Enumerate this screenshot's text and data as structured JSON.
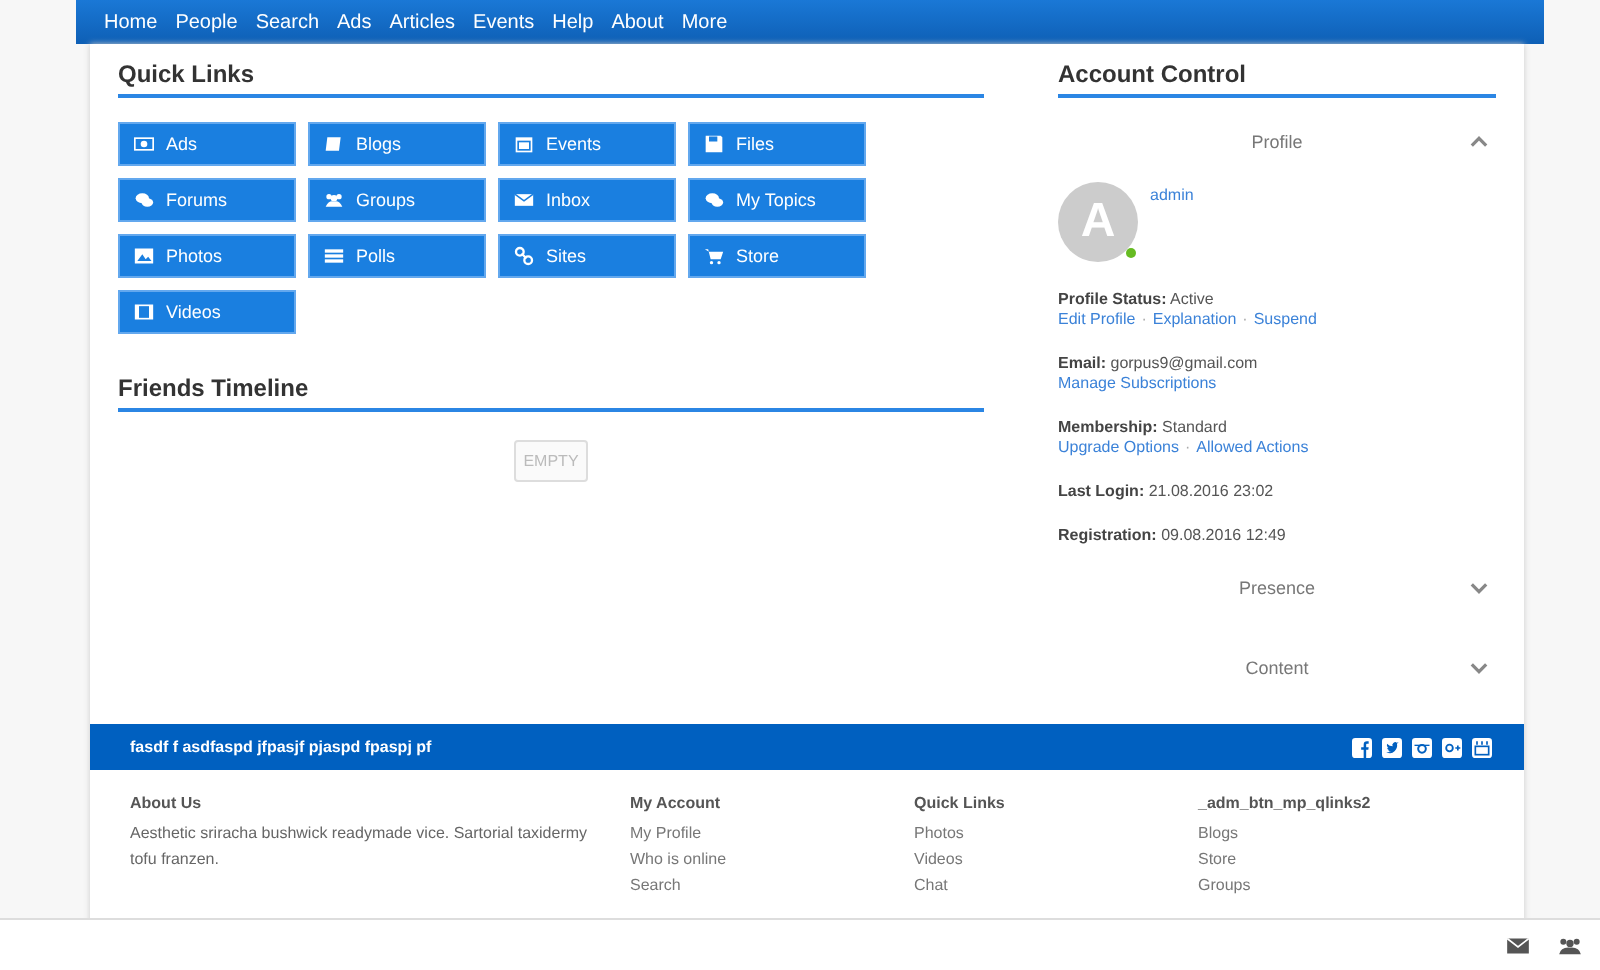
{
  "nav": {
    "items": [
      "Home",
      "People",
      "Search",
      "Ads",
      "Articles",
      "Events",
      "Help",
      "About",
      "More"
    ]
  },
  "quick_links": {
    "title": "Quick Links",
    "buttons": [
      "Ads",
      "Blogs",
      "Events",
      "Files",
      "Forums",
      "Groups",
      "Inbox",
      "My Topics",
      "Photos",
      "Polls",
      "Sites",
      "Store",
      "Videos"
    ]
  },
  "friends_timeline": {
    "title": "Friends Timeline",
    "empty_label": "EMPTY"
  },
  "account_control": {
    "title": "Account Control",
    "separator": "·",
    "sections": [
      {
        "title": "Profile",
        "expanded": true,
        "content": {
          "avatar_letter": "A",
          "online": true,
          "username": "admin",
          "fields": [
            {
              "label": "Profile Status:",
              "value": "Active",
              "links": [
                "Edit Profile",
                "Explanation",
                "Suspend"
              ]
            },
            {
              "label": "Email:",
              "value": "gorpus9@gmail.com",
              "links": [
                "Manage Subscriptions"
              ]
            },
            {
              "label": "Membership:",
              "value": "Standard",
              "links": [
                "Upgrade Options",
                "Allowed Actions"
              ]
            },
            {
              "label": "Last Login:",
              "value": "21.08.2016 23:02"
            },
            {
              "label": "Registration:",
              "value": "09.08.2016 12:49"
            }
          ]
        }
      },
      {
        "title": "Presence",
        "expanded": false
      },
      {
        "title": "Content",
        "expanded": false
      }
    ]
  },
  "footer": {
    "bar_text": "fasdf f asdfaspd jfpasjf pjaspd fpaspj pf",
    "columns": [
      {
        "title": "About Us",
        "text": "Aesthetic sriracha bushwick readymade vice. Sartorial taxidermy tofu franzen."
      },
      {
        "title": "My Account",
        "items": [
          "My Profile",
          "Who is online",
          "Search"
        ]
      },
      {
        "title": "Quick Links",
        "items": [
          "Photos",
          "Videos",
          "Chat"
        ]
      },
      {
        "title": "_adm_btn_mp_qlinks2",
        "items": [
          "Blogs",
          "Store",
          "Groups"
        ]
      }
    ]
  }
}
